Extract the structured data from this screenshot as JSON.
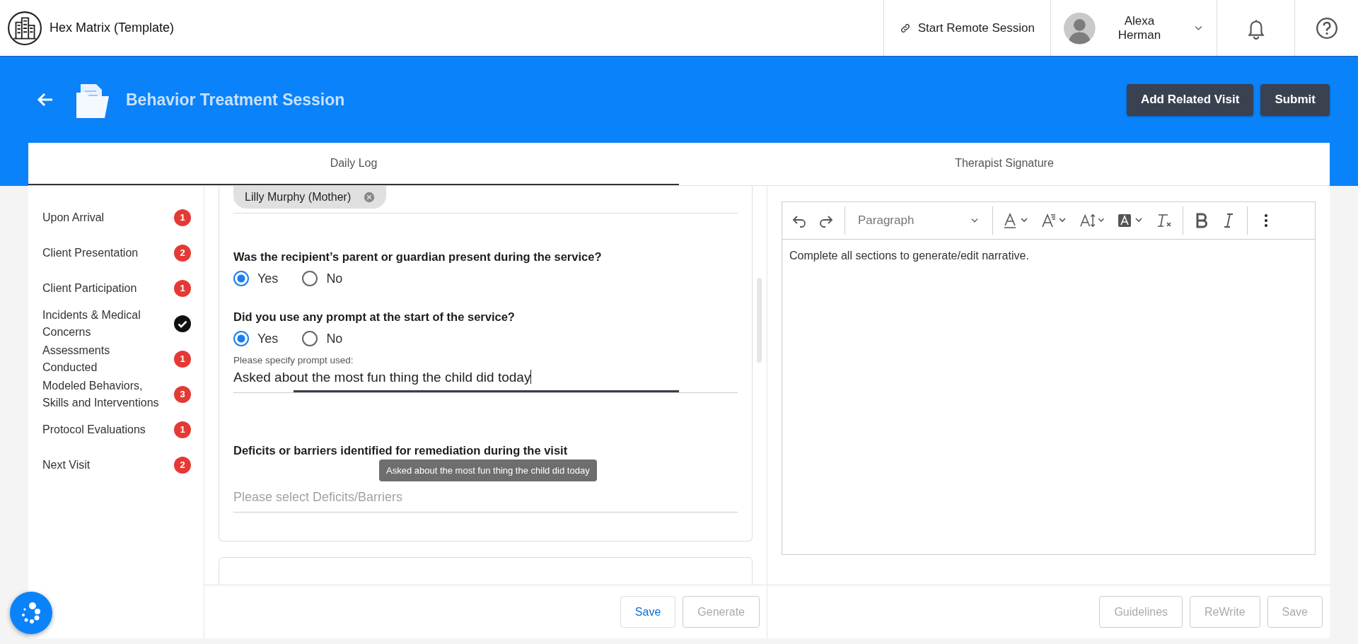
{
  "app": {
    "title": "Hex Matrix (Template)"
  },
  "top_actions": {
    "remote_session": "Start Remote Session",
    "user_name": "Alexa Herman"
  },
  "header": {
    "title": "Behavior Treatment Session",
    "buttons": [
      "Add Related Visit",
      "Submit"
    ]
  },
  "tabs": [
    {
      "label": "Daily Log",
      "selected": true
    },
    {
      "label": "Therapist Signature",
      "selected": false
    }
  ],
  "sections": [
    {
      "label": "Upon Arrival",
      "kind": "count",
      "count": "1"
    },
    {
      "label": "Client Presentation",
      "kind": "count",
      "count": "2"
    },
    {
      "label": "Client Participation",
      "kind": "count",
      "count": "1"
    },
    {
      "label": "Incidents & Medical Concerns",
      "kind": "done"
    },
    {
      "label": "Assessments Conducted",
      "kind": "count",
      "count": "1"
    },
    {
      "label": "Modeled Behaviors, Skills and Interventions",
      "kind": "count",
      "count": "3"
    },
    {
      "label": "Protocol Evaluations",
      "kind": "count",
      "count": "1"
    },
    {
      "label": "Next Visit",
      "kind": "count",
      "count": "2"
    }
  ],
  "form": {
    "chips": [
      "Lilly Murphy (Mother)"
    ],
    "questions": [
      {
        "kind": "radio",
        "question": "Was the recipient’s parent or guardian present during the service?",
        "options": [
          {
            "label": "Yes",
            "selected": true
          },
          {
            "label": "No",
            "selected": false
          }
        ]
      },
      {
        "kind": "radio",
        "question": "Did you use any prompt at the start of the service?",
        "options": [
          {
            "label": "Yes",
            "selected": true
          },
          {
            "label": "No",
            "selected": false
          }
        ],
        "detail": {
          "label": "Please specify prompt used:",
          "value": "Asked about the most fun thing the child did today"
        }
      },
      {
        "kind": "select",
        "question": "Deficits or barriers identified for remediation during the visit",
        "placeholder": "Please select Deficits/Barriers",
        "tooltip": "Asked about the most fun thing the child did today"
      }
    ]
  },
  "form_buttons": [
    {
      "label": "Save",
      "disabled": false
    },
    {
      "label": "Generate",
      "disabled": true
    }
  ],
  "editor": {
    "block_format": "Paragraph",
    "text": "Complete all sections to generate/edit narrative."
  },
  "editor_buttons": [
    {
      "label": "Guidelines",
      "disabled": true
    },
    {
      "label": "ReWrite",
      "disabled": true
    },
    {
      "label": "Save",
      "disabled": true
    }
  ]
}
